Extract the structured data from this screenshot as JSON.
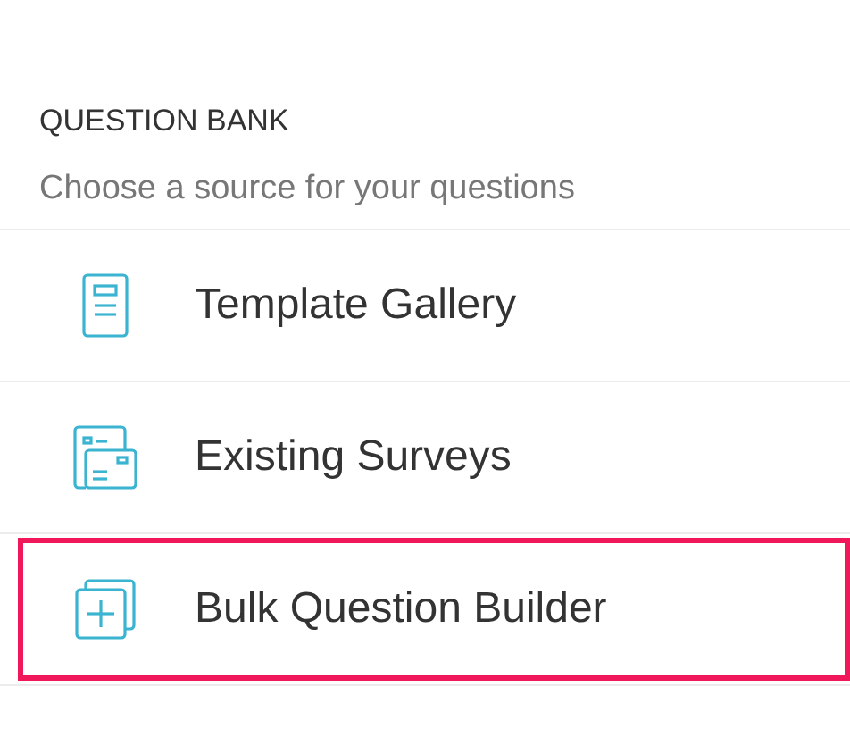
{
  "heading": "QUESTION BANK",
  "subtitle": "Choose a source for your questions",
  "sources": [
    {
      "kind": "template",
      "label": "Template Gallery",
      "selected": false
    },
    {
      "kind": "existing",
      "label": "Existing Surveys",
      "selected": false
    },
    {
      "kind": "bulk",
      "label": "Bulk Question Builder",
      "selected": true
    }
  ]
}
